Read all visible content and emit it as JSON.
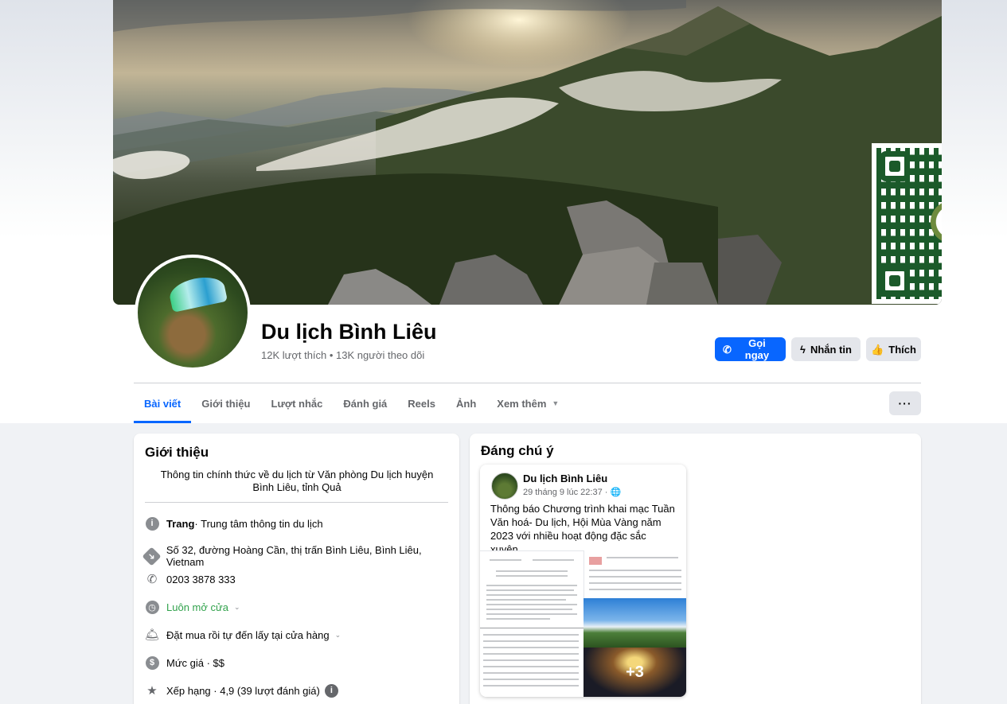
{
  "page": {
    "name": "Du lịch Bình Liêu",
    "stats": "12K lượt thích • 13K người theo dõi"
  },
  "actions": {
    "call": "Gọi ngay",
    "message": "Nhắn tin",
    "like": "Thích"
  },
  "tabs": [
    "Bài viết",
    "Giới thiệu",
    "Lượt nhắc",
    "Đánh giá",
    "Reels",
    "Ảnh",
    "Xem thêm"
  ],
  "more_menu": "···",
  "intro": {
    "title": "Giới thiệu",
    "description": "Thông tin chính thức về du lịch từ Văn phòng Du lịch huyện Bình Liêu, tỉnh Quả",
    "category_prefix": "Trang",
    "category": " · Trung tâm thông tin du lịch",
    "address": "Số 32, đường Hoàng Cần, thị trấn Bình Liêu, Bình Liêu, Vietnam",
    "phone": "0203 3878 333",
    "hours": "Luôn mở cửa",
    "service": "Đặt mua rồi tự đến lấy tại cửa hàng",
    "price": "Mức giá · $$",
    "rating": "Xếp hạng · 4,9 (39 lượt đánh giá)"
  },
  "notable": {
    "title": "Đáng chú ý",
    "post": {
      "author": "Du lịch Bình Liêu",
      "time": "29 tháng 9 lúc 22:37 ·",
      "text": "Thông báo Chương trình khai mạc Tuần Văn hoá- Du lịch, Hội Mùa Vàng năm 2023 với nhiều hoạt động đặc sắc xuyên...",
      "more_photos": "+3"
    }
  },
  "colors": {
    "accent": "#0866ff",
    "secondary_button": "#e4e6eb",
    "open_status": "#31a24c"
  }
}
